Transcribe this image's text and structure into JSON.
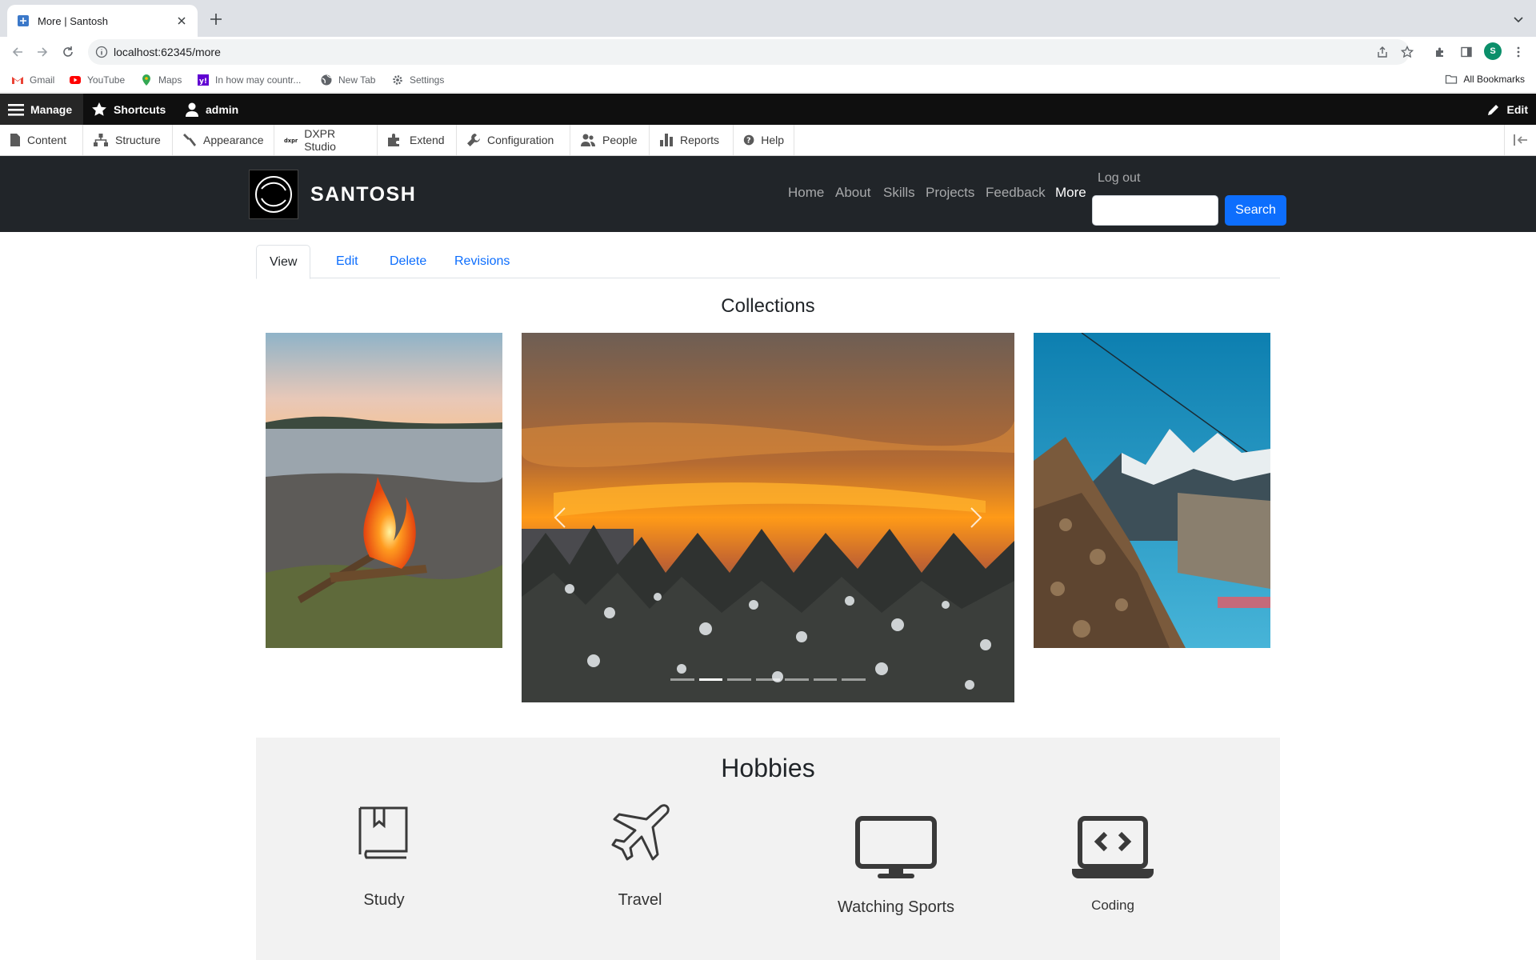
{
  "browser": {
    "tab_title": "More | Santosh",
    "url": "localhost:62345/more",
    "bookmarks": [
      "Gmail",
      "YouTube",
      "Maps",
      "In how may countr...",
      "New Tab",
      "Settings"
    ],
    "all_bookmarks": "All Bookmarks",
    "profile_initial": "S"
  },
  "admin_toolbar": {
    "manage": "Manage",
    "shortcuts": "Shortcuts",
    "user": "admin",
    "edit": "Edit",
    "tray": [
      "Content",
      "Structure",
      "Appearance",
      "DXPR Studio",
      "Extend",
      "Configuration",
      "People",
      "Reports",
      "Help"
    ]
  },
  "site": {
    "name": "SANTOSH",
    "logo_text": "santosh",
    "nav": [
      "Home",
      "About",
      "Skills",
      "Projects",
      "Feedback",
      "More"
    ],
    "active_nav": "More",
    "logout": "Log out",
    "search_button": "Search"
  },
  "tasks": [
    "View",
    "Edit",
    "Delete",
    "Revisions"
  ],
  "collections": {
    "title": "Collections",
    "slides_count": 7,
    "active_slide": 2
  },
  "hobbies": {
    "title": "Hobbies",
    "items": [
      {
        "label": "Study",
        "icon": "book-icon"
      },
      {
        "label": "Travel",
        "icon": "airplane-icon"
      },
      {
        "label": "Watching Sports",
        "icon": "desktop-monitor-icon"
      },
      {
        "label": "Coding",
        "icon": "laptop-code-icon"
      }
    ]
  },
  "colors": {
    "admin_bar": "#0f0f0f",
    "site_header": "#212529",
    "primary": "#0d6efd",
    "hobbies_bg": "#f2f2f2"
  }
}
